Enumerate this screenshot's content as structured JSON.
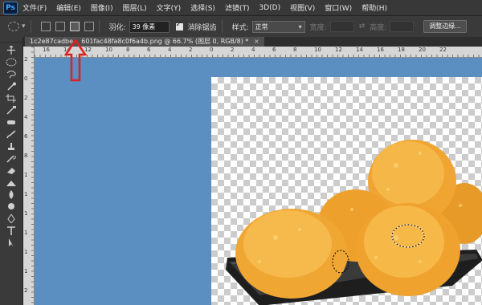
{
  "app": {
    "logo": "Ps"
  },
  "menu": [
    "文件(F)",
    "编辑(E)",
    "图像(I)",
    "图层(L)",
    "文字(Y)",
    "选择(S)",
    "滤镜(T)",
    "3D(D)",
    "视图(V)",
    "窗口(W)",
    "帮助(H)"
  ],
  "options": {
    "feather_label": "羽化:",
    "feather_value": "39 像素",
    "antialias_label": "消除锯齿",
    "style_label": "样式:",
    "style_value": "正常",
    "width_label": "宽度:",
    "height_label": "高度:",
    "refine_edge_button": "调整边缘..."
  },
  "document": {
    "tab_title": "1c2e87cadbe... 601fac48fa8c0f6a4b.png @ 66.7% (图层 0, RGB/8) *",
    "close": "×"
  },
  "ruler": {
    "top_labels": [
      "16",
      "14",
      "12",
      "10",
      "8",
      "6",
      "4",
      "2",
      "0",
      "2",
      "4",
      "6",
      "8",
      "10",
      "12",
      "14",
      "16",
      "18",
      "20",
      "22"
    ],
    "left_labels": [
      "2",
      "0",
      "2",
      "4",
      "6",
      "8",
      "1",
      "1",
      "1",
      "1",
      "1",
      "1",
      "2"
    ]
  },
  "colors": {
    "canvas_bg": "#5b8ec1",
    "annotation_arrow": "#e02020",
    "food": "#f2a230"
  },
  "tools": [
    "move-tool",
    "marquee-tool",
    "lasso-tool",
    "quick-select-tool",
    "crop-tool",
    "eyedropper-tool",
    "healing-tool",
    "brush-tool",
    "clone-stamp-tool",
    "history-brush-tool",
    "eraser-tool",
    "gradient-tool",
    "blur-tool",
    "dodge-tool",
    "pen-tool",
    "type-tool",
    "path-select-tool"
  ]
}
